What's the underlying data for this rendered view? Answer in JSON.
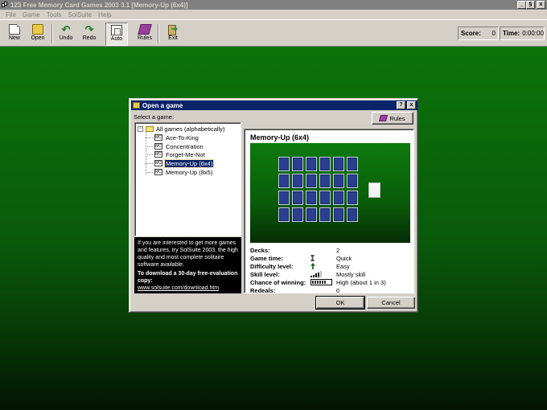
{
  "window": {
    "title": "123 Free Memory Card Games 2003 3.1  [Memory-Up (6x4)]",
    "controls": [
      "_",
      "§",
      "x"
    ]
  },
  "menu": [
    "File",
    "Game",
    "Tools",
    "SolSuite",
    "Help"
  ],
  "toolbar": {
    "buttons": [
      {
        "label": "New",
        "icon": "new-document-icon"
      },
      {
        "label": "Open",
        "icon": "open-folder-icon"
      },
      {
        "label": "Undo",
        "icon": "undo-arrow-icon"
      },
      {
        "label": "Redo",
        "icon": "redo-arrow-icon"
      },
      {
        "label": "Auto",
        "icon": "auto-icon"
      },
      {
        "label": "Rules",
        "icon": "rules-book-icon"
      },
      {
        "label": "Exit",
        "icon": "exit-door-icon"
      }
    ],
    "undo_glyph": "↶",
    "redo_glyph": "↷"
  },
  "status": {
    "score_label": "Score:",
    "score_value": "0",
    "time_label": "Time:",
    "time_value": "0:00:00"
  },
  "dialog": {
    "title": "Open a game",
    "help_btn": "?",
    "close_btn": "x",
    "select_label": "Select a game:",
    "rules_label": "Rules",
    "tree": {
      "expander": "−",
      "root": "All games (alphabetically)",
      "card_icon_text": "MC",
      "items": [
        "Ace-To-King",
        "Concentration",
        "Forget-Me-Not",
        "Memory-Up (6x4)",
        "Memory-Up (8x5)"
      ],
      "selected": "Memory-Up (6x4)"
    },
    "promo": {
      "text": "If you are interested to get more games and features, try SolSuite 2003, the high quality and most complete solitaire software available.",
      "download": "To download a 30-day free-evaluation copy:",
      "link": "www.solsuite.com/download.htm"
    },
    "game": {
      "name": "Memory-Up (6x4)",
      "preview": {
        "rows": 4,
        "columns": 6,
        "face_down_cards": 24,
        "spare_cards": 1
      },
      "stats": [
        {
          "label": "Decks:",
          "value": "2",
          "indicator": ""
        },
        {
          "label": "Game time:",
          "value": "Quick",
          "indicator": "hourglass-icon"
        },
        {
          "label": "Difficulty level:",
          "value": "Easy",
          "indicator": "up-arrow-icon"
        },
        {
          "label": "Skill level:",
          "value": "Mostly skill",
          "indicator": "skill-bars-icon"
        },
        {
          "label": "Chance of winning:",
          "value": "High (about 1 in 3)",
          "indicator": "chance-meter-icon"
        },
        {
          "label": "Redeals:",
          "value": "0",
          "indicator": ""
        }
      ],
      "skill_bars_filled": 4,
      "chance_fraction": 0.8
    },
    "ok_label": "OK",
    "cancel_label": "Cancel"
  },
  "colors": {
    "dialog_title_bar": "#0a246a",
    "table_green": "#0a7a0a",
    "card_back": "#2a3f8f"
  }
}
